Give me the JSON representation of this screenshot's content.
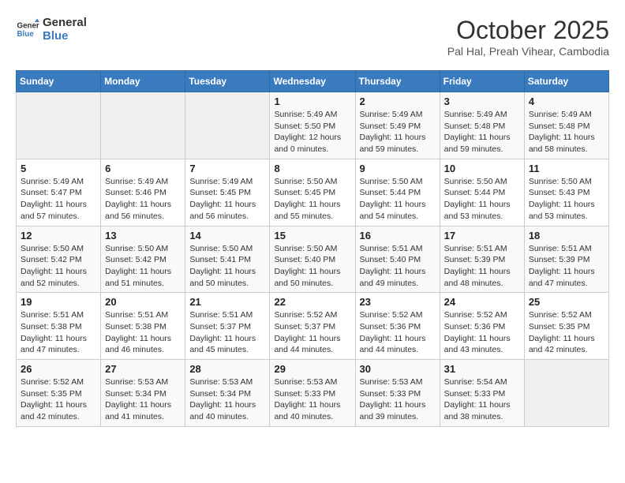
{
  "header": {
    "logo_line1": "General",
    "logo_line2": "Blue",
    "month": "October 2025",
    "location": "Pal Hal, Preah Vihear, Cambodia"
  },
  "weekdays": [
    "Sunday",
    "Monday",
    "Tuesday",
    "Wednesday",
    "Thursday",
    "Friday",
    "Saturday"
  ],
  "weeks": [
    [
      {
        "day": "",
        "info": ""
      },
      {
        "day": "",
        "info": ""
      },
      {
        "day": "",
        "info": ""
      },
      {
        "day": "1",
        "info": "Sunrise: 5:49 AM\nSunset: 5:50 PM\nDaylight: 12 hours\nand 0 minutes."
      },
      {
        "day": "2",
        "info": "Sunrise: 5:49 AM\nSunset: 5:49 PM\nDaylight: 11 hours\nand 59 minutes."
      },
      {
        "day": "3",
        "info": "Sunrise: 5:49 AM\nSunset: 5:48 PM\nDaylight: 11 hours\nand 59 minutes."
      },
      {
        "day": "4",
        "info": "Sunrise: 5:49 AM\nSunset: 5:48 PM\nDaylight: 11 hours\nand 58 minutes."
      }
    ],
    [
      {
        "day": "5",
        "info": "Sunrise: 5:49 AM\nSunset: 5:47 PM\nDaylight: 11 hours\nand 57 minutes."
      },
      {
        "day": "6",
        "info": "Sunrise: 5:49 AM\nSunset: 5:46 PM\nDaylight: 11 hours\nand 56 minutes."
      },
      {
        "day": "7",
        "info": "Sunrise: 5:49 AM\nSunset: 5:45 PM\nDaylight: 11 hours\nand 56 minutes."
      },
      {
        "day": "8",
        "info": "Sunrise: 5:50 AM\nSunset: 5:45 PM\nDaylight: 11 hours\nand 55 minutes."
      },
      {
        "day": "9",
        "info": "Sunrise: 5:50 AM\nSunset: 5:44 PM\nDaylight: 11 hours\nand 54 minutes."
      },
      {
        "day": "10",
        "info": "Sunrise: 5:50 AM\nSunset: 5:44 PM\nDaylight: 11 hours\nand 53 minutes."
      },
      {
        "day": "11",
        "info": "Sunrise: 5:50 AM\nSunset: 5:43 PM\nDaylight: 11 hours\nand 53 minutes."
      }
    ],
    [
      {
        "day": "12",
        "info": "Sunrise: 5:50 AM\nSunset: 5:42 PM\nDaylight: 11 hours\nand 52 minutes."
      },
      {
        "day": "13",
        "info": "Sunrise: 5:50 AM\nSunset: 5:42 PM\nDaylight: 11 hours\nand 51 minutes."
      },
      {
        "day": "14",
        "info": "Sunrise: 5:50 AM\nSunset: 5:41 PM\nDaylight: 11 hours\nand 50 minutes."
      },
      {
        "day": "15",
        "info": "Sunrise: 5:50 AM\nSunset: 5:40 PM\nDaylight: 11 hours\nand 50 minutes."
      },
      {
        "day": "16",
        "info": "Sunrise: 5:51 AM\nSunset: 5:40 PM\nDaylight: 11 hours\nand 49 minutes."
      },
      {
        "day": "17",
        "info": "Sunrise: 5:51 AM\nSunset: 5:39 PM\nDaylight: 11 hours\nand 48 minutes."
      },
      {
        "day": "18",
        "info": "Sunrise: 5:51 AM\nSunset: 5:39 PM\nDaylight: 11 hours\nand 47 minutes."
      }
    ],
    [
      {
        "day": "19",
        "info": "Sunrise: 5:51 AM\nSunset: 5:38 PM\nDaylight: 11 hours\nand 47 minutes."
      },
      {
        "day": "20",
        "info": "Sunrise: 5:51 AM\nSunset: 5:38 PM\nDaylight: 11 hours\nand 46 minutes."
      },
      {
        "day": "21",
        "info": "Sunrise: 5:51 AM\nSunset: 5:37 PM\nDaylight: 11 hours\nand 45 minutes."
      },
      {
        "day": "22",
        "info": "Sunrise: 5:52 AM\nSunset: 5:37 PM\nDaylight: 11 hours\nand 44 minutes."
      },
      {
        "day": "23",
        "info": "Sunrise: 5:52 AM\nSunset: 5:36 PM\nDaylight: 11 hours\nand 44 minutes."
      },
      {
        "day": "24",
        "info": "Sunrise: 5:52 AM\nSunset: 5:36 PM\nDaylight: 11 hours\nand 43 minutes."
      },
      {
        "day": "25",
        "info": "Sunrise: 5:52 AM\nSunset: 5:35 PM\nDaylight: 11 hours\nand 42 minutes."
      }
    ],
    [
      {
        "day": "26",
        "info": "Sunrise: 5:52 AM\nSunset: 5:35 PM\nDaylight: 11 hours\nand 42 minutes."
      },
      {
        "day": "27",
        "info": "Sunrise: 5:53 AM\nSunset: 5:34 PM\nDaylight: 11 hours\nand 41 minutes."
      },
      {
        "day": "28",
        "info": "Sunrise: 5:53 AM\nSunset: 5:34 PM\nDaylight: 11 hours\nand 40 minutes."
      },
      {
        "day": "29",
        "info": "Sunrise: 5:53 AM\nSunset: 5:33 PM\nDaylight: 11 hours\nand 40 minutes."
      },
      {
        "day": "30",
        "info": "Sunrise: 5:53 AM\nSunset: 5:33 PM\nDaylight: 11 hours\nand 39 minutes."
      },
      {
        "day": "31",
        "info": "Sunrise: 5:54 AM\nSunset: 5:33 PM\nDaylight: 11 hours\nand 38 minutes."
      },
      {
        "day": "",
        "info": ""
      }
    ]
  ]
}
